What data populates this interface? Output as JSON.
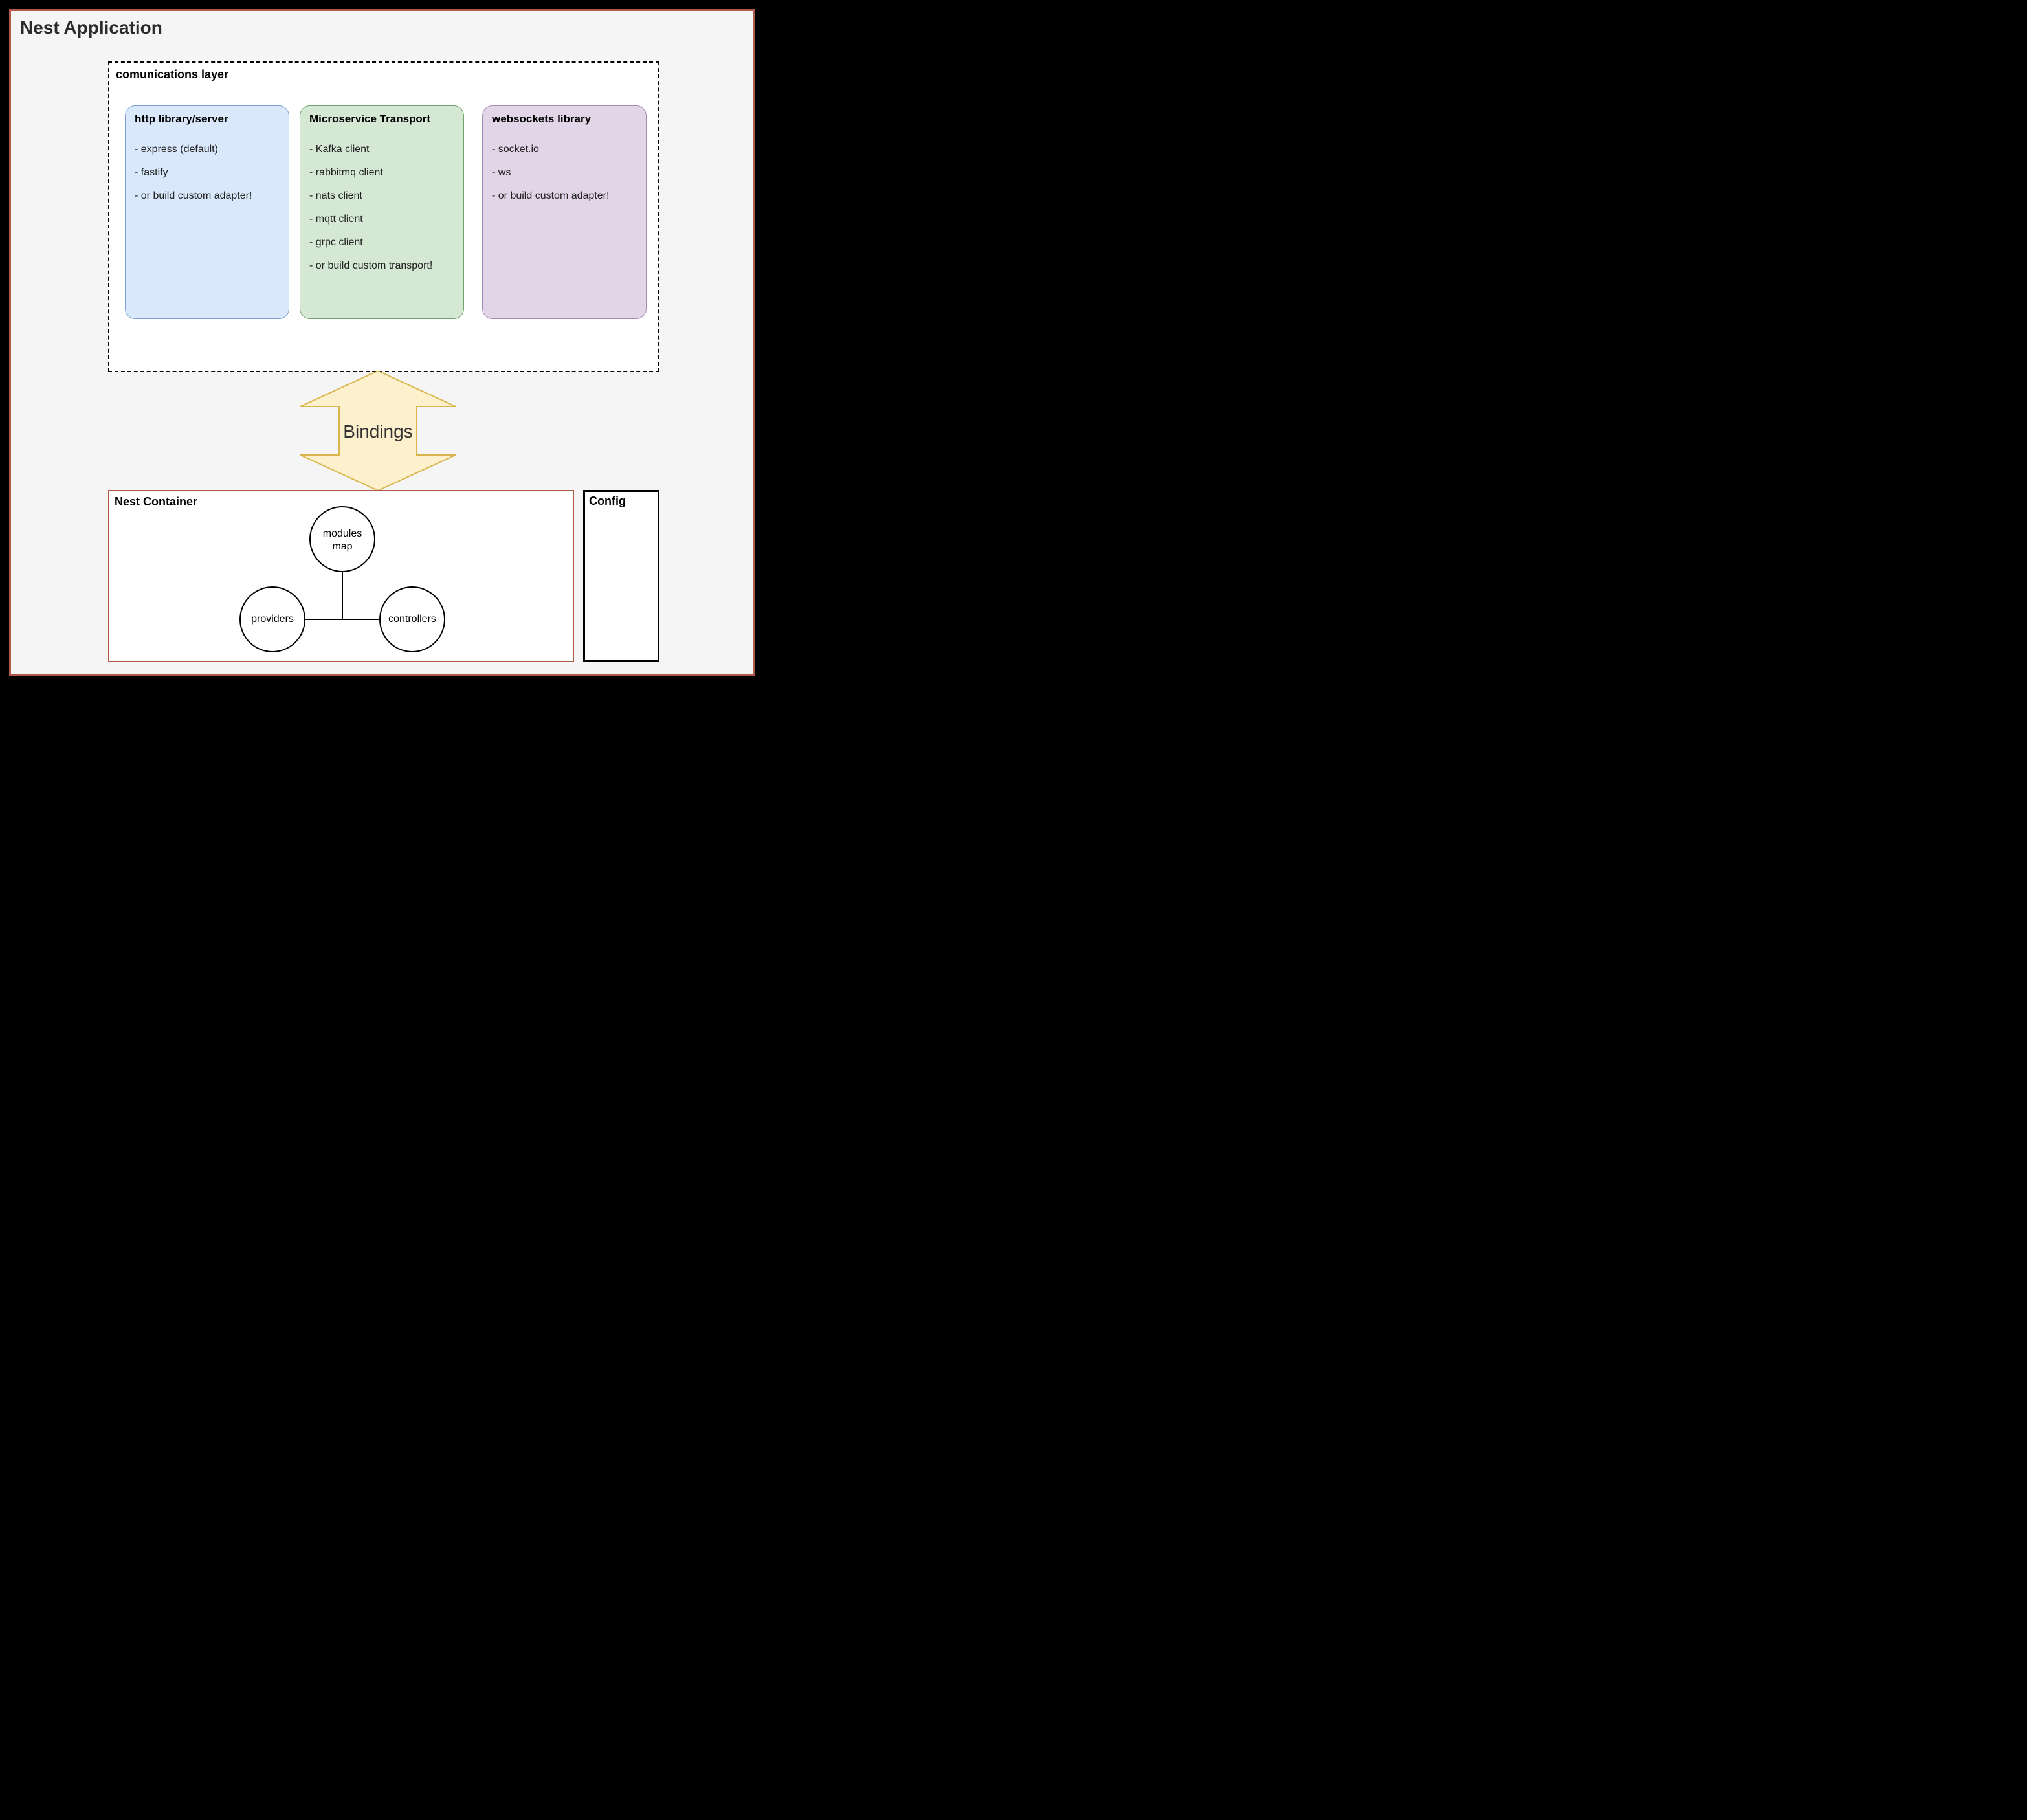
{
  "app": {
    "title": "Nest Application"
  },
  "comms": {
    "title": "comunications layer",
    "pillars": {
      "http": {
        "title": "http library/server",
        "items": [
          "- express (default)",
          "- fastify",
          "- or build custom adapter!"
        ]
      },
      "microservice": {
        "title": "Microservice Transport",
        "items": [
          "- Kafka client",
          "- rabbitmq client",
          "- nats client",
          "- mqtt client",
          "- grpc client",
          "- or build custom transport!"
        ]
      },
      "websockets": {
        "title": "websockets library",
        "items": [
          "- socket.io",
          "- ws",
          "- or build custom adapter!"
        ]
      }
    }
  },
  "bindings": {
    "label": "Bindings"
  },
  "container": {
    "title": "Nest Container",
    "nodes": {
      "modules_l1": "modules",
      "modules_l2": "map",
      "providers": "providers",
      "controllers": "controllers"
    }
  },
  "config": {
    "title": "Config"
  },
  "colors": {
    "outer_border": "#b15a4a",
    "bindings_fill": "#fdf1cd",
    "bindings_stroke": "#d9b54c"
  }
}
